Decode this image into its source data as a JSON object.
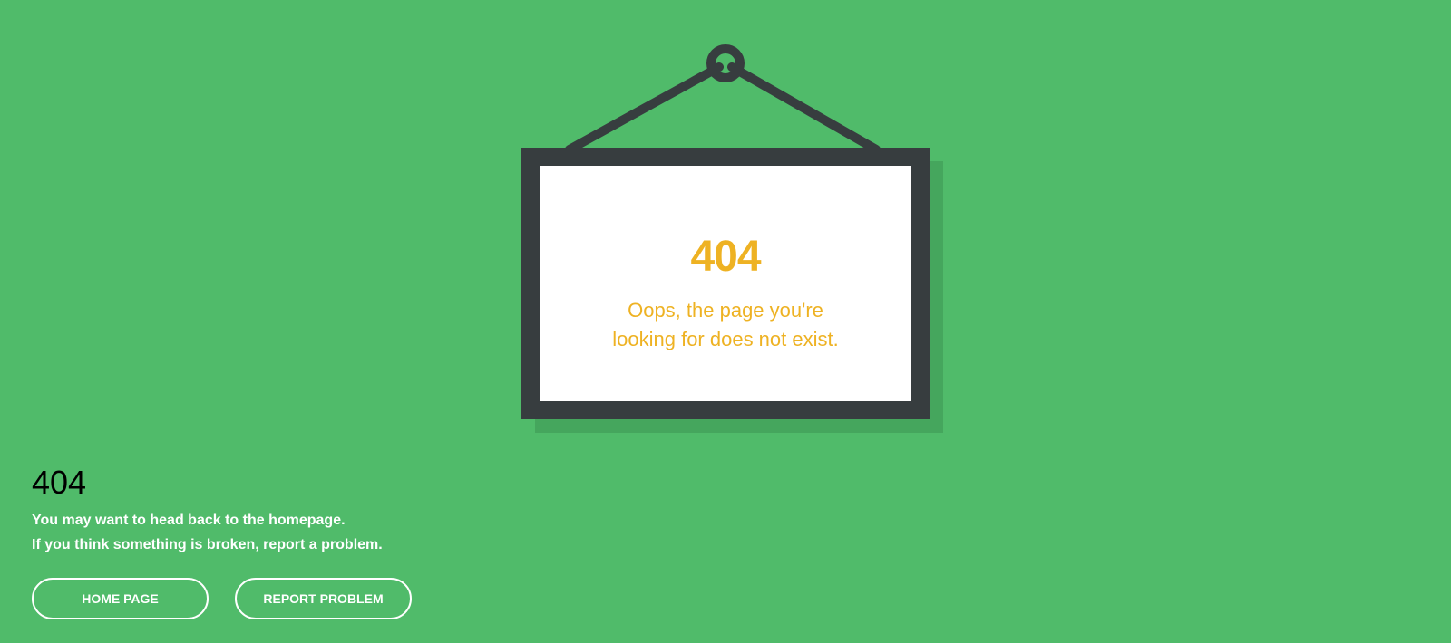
{
  "colors": {
    "background": "#50bb6a",
    "frame": "#373d3f",
    "accent": "#eeb223",
    "shadow": "#45a65d"
  },
  "sign": {
    "icon": "hanging-frame-icon",
    "code": "404",
    "message": "Oops, the page you're looking for does not exist."
  },
  "info": {
    "title": "404",
    "line1": "You may want to head back to the homepage.",
    "line2": "If you think something is broken, report a problem."
  },
  "buttons": {
    "home_label": "HOME PAGE",
    "report_label": "REPORT PROBLEM"
  }
}
